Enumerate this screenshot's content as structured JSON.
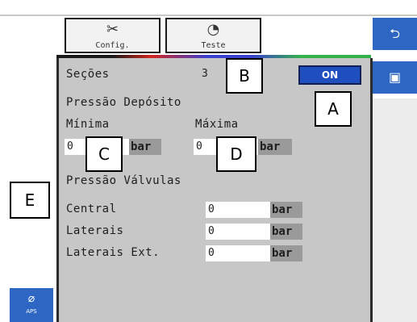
{
  "tabs": {
    "config": {
      "label": "Config.",
      "icon": "tools-icon"
    },
    "teste": {
      "label": "Teste",
      "icon": "gauge-icon"
    }
  },
  "secoes": {
    "label": "Seções",
    "value": "3",
    "toggle": "ON"
  },
  "pressao_deposito": {
    "title": "Pressão Depósito",
    "minima_label": "Mínima",
    "maxima_label": "Máxima",
    "minima_value": "0",
    "maxima_value": "0",
    "unit": "bar"
  },
  "pressao_valvulas": {
    "title": "Pressão Válvulas",
    "rows": [
      {
        "label": "Central",
        "value": "0",
        "unit": "bar"
      },
      {
        "label": "Laterais",
        "value": "0",
        "unit": "bar"
      },
      {
        "label": "Laterais Ext.",
        "value": "0",
        "unit": "bar"
      }
    ]
  },
  "side_buttons": {
    "back": {
      "icon": "back-arrow-icon",
      "glyph": "⮌"
    },
    "save": {
      "icon": "save-icon",
      "glyph": "▣"
    }
  },
  "map_button": {
    "icon": "leaf-icon",
    "glyph": "⌀",
    "label": "APS"
  },
  "callouts": {
    "a": "A",
    "b": "B",
    "c": "C",
    "d": "D",
    "e": "E"
  },
  "colors": {
    "panel": "#c7c7c7",
    "accent_blue": "#2d66c3",
    "on_button": "#1f4fbf",
    "unit_gray": "#9a9a9a"
  }
}
